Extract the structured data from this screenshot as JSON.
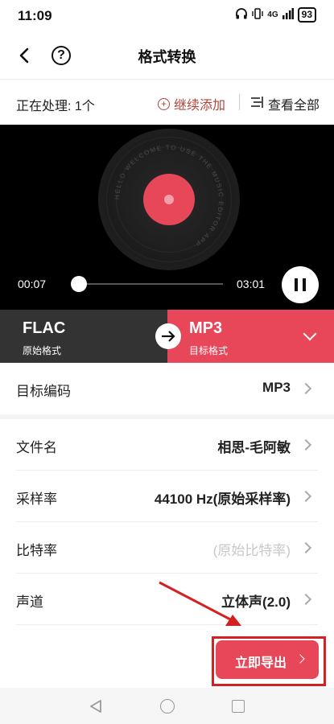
{
  "status_bar": {
    "time": "11:09",
    "network": "4G",
    "battery": "93"
  },
  "header": {
    "title": "格式转换",
    "help": "?"
  },
  "processing": {
    "label": "正在处理: 1个",
    "add_more": "继续添加",
    "view_all": "查看全部"
  },
  "player": {
    "current_time": "00:07",
    "duration": "03:01",
    "progress": 0.04,
    "disc_text": "HELLO WELCOME TO USE THE MUSIC EDITOR APP"
  },
  "format": {
    "source_name": "FLAC",
    "source_sub": "原始格式",
    "target_name": "MP3",
    "target_sub": "目标格式"
  },
  "settings": [
    {
      "label": "目标编码",
      "value": "MP3",
      "muted": false
    },
    {
      "label": "文件名",
      "value": "相思-毛阿敏",
      "muted": false
    },
    {
      "label": "采样率",
      "value": "44100 Hz(原始采样率)",
      "muted": false
    },
    {
      "label": "比特率",
      "value": "(原始比特率)",
      "muted": true
    },
    {
      "label": "声道",
      "value": "立体声(2.0)",
      "muted": false
    }
  ],
  "export": {
    "label": "立即导出"
  },
  "colors": {
    "accent": "#e8475a",
    "dark": "#333333",
    "annotation": "#d42020"
  }
}
